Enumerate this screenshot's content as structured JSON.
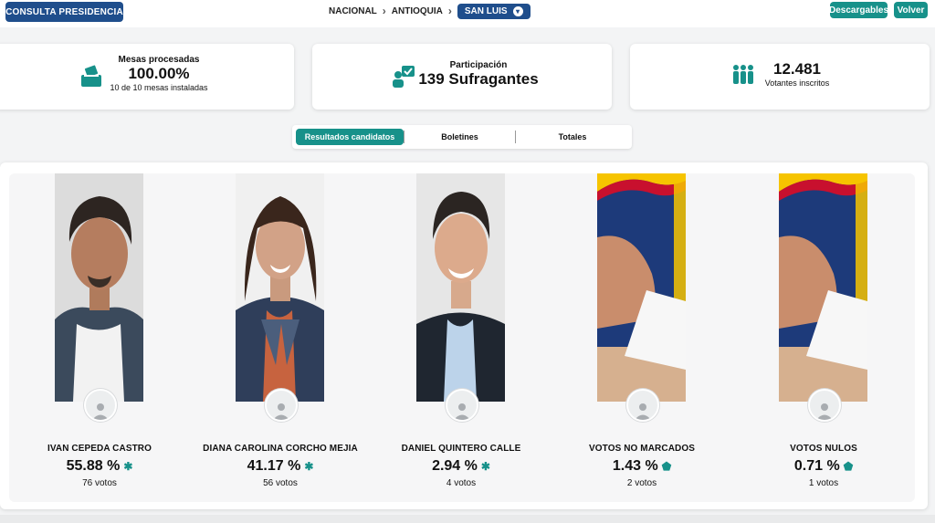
{
  "header": {
    "consulta_button": "CONSULTA PRESIDENCIA",
    "breadcrumb": [
      "NACIONAL",
      "ANTIOQUIA",
      "SAN LUIS"
    ],
    "descargables_button": "Descargables",
    "volver_button": "Volver"
  },
  "stats": {
    "mesas": {
      "label": "Mesas procesadas",
      "value": "100.00%",
      "sub": "10 de 10 mesas instaladas"
    },
    "participacion": {
      "label": "Participación",
      "value": "139 Sufragantes"
    },
    "votantes": {
      "value": "12.481",
      "sub": "Votantes inscritos"
    }
  },
  "tabs": [
    "Resultados candidatos",
    "Boletines",
    "Totales"
  ],
  "candidates": [
    {
      "name": "IVAN CEPEDA CASTRO",
      "pct": "55.88 %",
      "votes": "76 votos"
    },
    {
      "name": "DIANA CAROLINA CORCHO MEJIA",
      "pct": "41.17 %",
      "votes": "56 votos"
    },
    {
      "name": "DANIEL QUINTERO CALLE",
      "pct": "2.94 %",
      "votes": "4 votos"
    },
    {
      "name": "VOTOS NO MARCADOS",
      "pct": "1.43 %",
      "votes": "2 votos"
    },
    {
      "name": "VOTOS NULOS",
      "pct": "0.71 %",
      "votes": "1 votos"
    }
  ],
  "colors": {
    "primary_blue": "#1f4e8c",
    "teal": "#17918a"
  }
}
